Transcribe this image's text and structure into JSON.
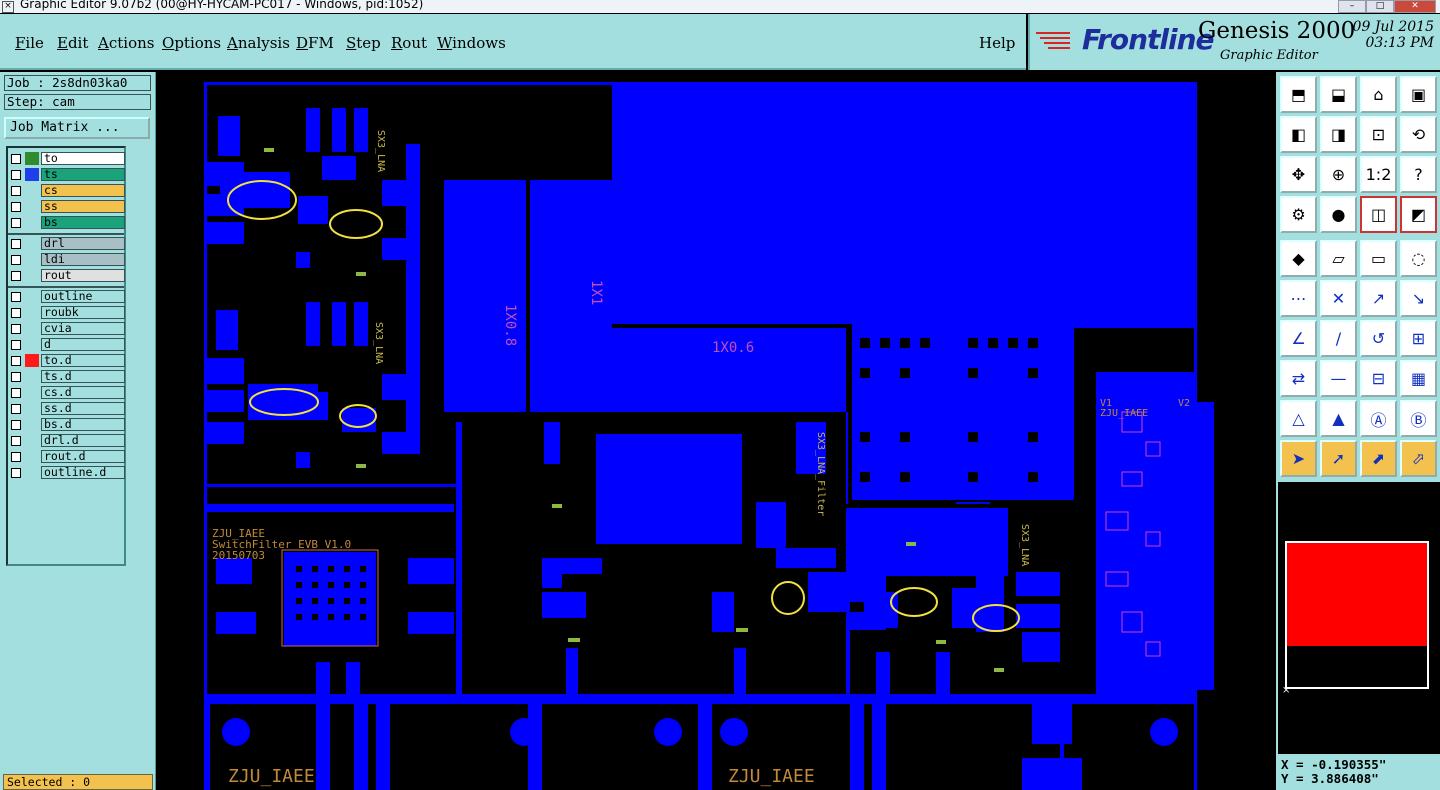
{
  "window": {
    "title": "Graphic Editor 9.07b2 (00@HY-HYCAM-PC017 - Windows, pid:1052)"
  },
  "menu": {
    "items": [
      {
        "label": "File",
        "u": "F",
        "rest": "ile"
      },
      {
        "label": "Edit",
        "u": "E",
        "rest": "dit"
      },
      {
        "label": "Actions",
        "u": "A",
        "rest": "ctions"
      },
      {
        "label": "Options",
        "u": "O",
        "rest": "ptions"
      },
      {
        "label": "Analysis",
        "u": "A",
        "rest": "nalysis"
      },
      {
        "label": "DFM",
        "u": "D",
        "rest": "FM"
      },
      {
        "label": "Step",
        "u": "S",
        "rest": "tep"
      },
      {
        "label": "Rout",
        "u": "R",
        "rest": "out"
      },
      {
        "label": "Windows",
        "u": "W",
        "rest": "indows"
      }
    ],
    "help": "Help"
  },
  "brand": {
    "logo": "Frontline",
    "product": "Genesis 2000",
    "subtitle": "Graphic Editor",
    "date": "09 Jul 2015",
    "time": "03:13 PM"
  },
  "job": {
    "job_label": "Job : 2s8dn03ka0",
    "step_label": "Step: cam",
    "matrix_button": "Job Matrix ..."
  },
  "layers": [
    {
      "name": "to",
      "swatch": "#2e8b2e",
      "bg": "#ffffff"
    },
    {
      "name": "ts",
      "swatch": "#1f3fe8",
      "bg": "#1aa37a"
    },
    {
      "name": "cs",
      "swatch": "",
      "bg": "#f2c14e"
    },
    {
      "name": "ss",
      "swatch": "",
      "bg": "#f2c14e"
    },
    {
      "name": "bs",
      "swatch": "",
      "bg": "#1aa37a"
    },
    {
      "name": "drl",
      "swatch": "",
      "bg": "#a9bfc6"
    },
    {
      "name": "ldi",
      "swatch": "",
      "bg": "#a9bfc6"
    },
    {
      "name": "rout",
      "swatch": "",
      "bg": "#e0e0e0"
    },
    {
      "name": "outline",
      "swatch": "",
      "bg": "#a3dfdf"
    },
    {
      "name": "roubk",
      "swatch": "",
      "bg": "#a3dfdf"
    },
    {
      "name": "cvia",
      "swatch": "",
      "bg": "#a3dfdf"
    },
    {
      "name": "d",
      "swatch": "",
      "bg": "#a3dfdf"
    },
    {
      "name": "to.d",
      "swatch": "#ff1a1a",
      "bg": "#a3dfdf"
    },
    {
      "name": "ts.d",
      "swatch": "",
      "bg": "#a3dfdf"
    },
    {
      "name": "cs.d",
      "swatch": "",
      "bg": "#a3dfdf"
    },
    {
      "name": "ss.d",
      "swatch": "",
      "bg": "#a3dfdf"
    },
    {
      "name": "bs.d",
      "swatch": "",
      "bg": "#a3dfdf"
    },
    {
      "name": "drl.d",
      "swatch": "",
      "bg": "#a3dfdf"
    },
    {
      "name": "rout.d",
      "swatch": "",
      "bg": "#a3dfdf"
    },
    {
      "name": "outline.d",
      "swatch": "",
      "bg": "#a3dfdf"
    }
  ],
  "status": {
    "selected": "Selected : 0",
    "x": "X = -0.190355\"",
    "y": "Y = 3.886408\""
  },
  "board_text": {
    "t1": "1X0.8",
    "t2": "1X1",
    "t3": "1X0.6",
    "lna1": "SX3_LNA",
    "lna2": "SX3_LNA",
    "lna3": "SX3_LNA_Filter",
    "lna4": "SX3_LNA",
    "zju1": "ZJU_IAEE",
    "zju_l2": "SwitchFilter_EVB_V1.0",
    "zju_l3": "20150703",
    "zju2": "ZJU_IAEE",
    "zju3": "ZJU_IAEE",
    "zju4": "ZJU_IAEE",
    "v1": "V1",
    "v2": "V2"
  },
  "colors": {
    "copper": "#0000ff",
    "panel": "#a3dfdf",
    "silk": "#c08a3a",
    "highlight": "#f0e040"
  },
  "toolbar_icons": [
    "zoom-home-icon",
    "zoom-in-icon",
    "home-icon",
    "window-icon",
    "pan-left-icon",
    "pan-right-icon",
    "fit-icon",
    "redraw-icon",
    "zoom-extents-icon",
    "center-icon",
    "scale-1to2-icon",
    "help-icon",
    "measure-icon",
    "snap-icon",
    "layer-display-icon",
    "feature-display-icon",
    "select-icon",
    "draw-icon",
    "ruler-icon",
    "circle-select-icon",
    "net-icon",
    "cross-icon",
    "connect-icon",
    "connect-alt-icon",
    "line-icon",
    "slash-icon",
    "arc-icon",
    "pad-icon",
    "move-icon",
    "minus-icon",
    "snap-center-icon",
    "array-icon",
    "triangle-icon",
    "triangle-alt-icon",
    "triangle-a-icon",
    "triangle-b-icon",
    "pointer-icon",
    "pointer-alt-icon",
    "pointer-box-icon",
    "pointer-route-icon"
  ]
}
